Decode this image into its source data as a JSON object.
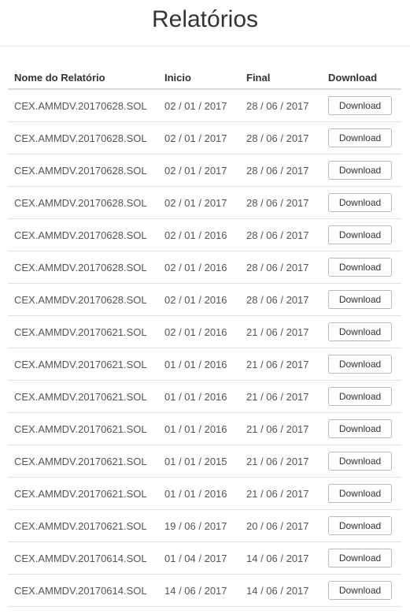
{
  "page": {
    "title": "Relatórios"
  },
  "table": {
    "headers": {
      "name": "Nome do Relatório",
      "start": "Inicio",
      "end": "Final",
      "download": "Download"
    },
    "rows": [
      {
        "name": "CEX.AMMDV.20170628.SOL",
        "start": "02 / 01 / 2017",
        "end": "28 / 06 / 2017",
        "button": "Download"
      },
      {
        "name": "CEX.AMMDV.20170628.SOL",
        "start": "02 / 01 / 2017",
        "end": "28 / 06 / 2017",
        "button": "Download"
      },
      {
        "name": "CEX.AMMDV.20170628.SOL",
        "start": "02 / 01 / 2017",
        "end": "28 / 06 / 2017",
        "button": "Download"
      },
      {
        "name": "CEX.AMMDV.20170628.SOL",
        "start": "02 / 01 / 2017",
        "end": "28 / 06 / 2017",
        "button": "Download"
      },
      {
        "name": "CEX.AMMDV.20170628.SOL",
        "start": "02 / 01 / 2016",
        "end": "28 / 06 / 2017",
        "button": "Download"
      },
      {
        "name": "CEX.AMMDV.20170628.SOL",
        "start": "02 / 01 / 2016",
        "end": "28 / 06 / 2017",
        "button": "Download"
      },
      {
        "name": "CEX.AMMDV.20170628.SOL",
        "start": "02 / 01 / 2016",
        "end": "28 / 06 / 2017",
        "button": "Download"
      },
      {
        "name": "CEX.AMMDV.20170621.SOL",
        "start": "02 / 01 / 2016",
        "end": "21 / 06 / 2017",
        "button": "Download"
      },
      {
        "name": "CEX.AMMDV.20170621.SOL",
        "start": "01 / 01 / 2016",
        "end": "21 / 06 / 2017",
        "button": "Download"
      },
      {
        "name": "CEX.AMMDV.20170621.SOL",
        "start": "01 / 01 / 2016",
        "end": "21 / 06 / 2017",
        "button": "Download"
      },
      {
        "name": "CEX.AMMDV.20170621.SOL",
        "start": "01 / 01 / 2016",
        "end": "21 / 06 / 2017",
        "button": "Download"
      },
      {
        "name": "CEX.AMMDV.20170621.SOL",
        "start": "01 / 01 / 2015",
        "end": "21 / 06 / 2017",
        "button": "Download"
      },
      {
        "name": "CEX.AMMDV.20170621.SOL",
        "start": "01 / 01 / 2016",
        "end": "21 / 06 / 2017",
        "button": "Download"
      },
      {
        "name": "CEX.AMMDV.20170621.SOL",
        "start": "19 / 06 / 2017",
        "end": "20 / 06 / 2017",
        "button": "Download"
      },
      {
        "name": "CEX.AMMDV.20170614.SOL",
        "start": "01 / 04 / 2017",
        "end": "14 / 06 / 2017",
        "button": "Download"
      },
      {
        "name": "CEX.AMMDV.20170614.SOL",
        "start": "14 / 06 / 2017",
        "end": "14 / 06 / 2017",
        "button": "Download"
      }
    ]
  }
}
